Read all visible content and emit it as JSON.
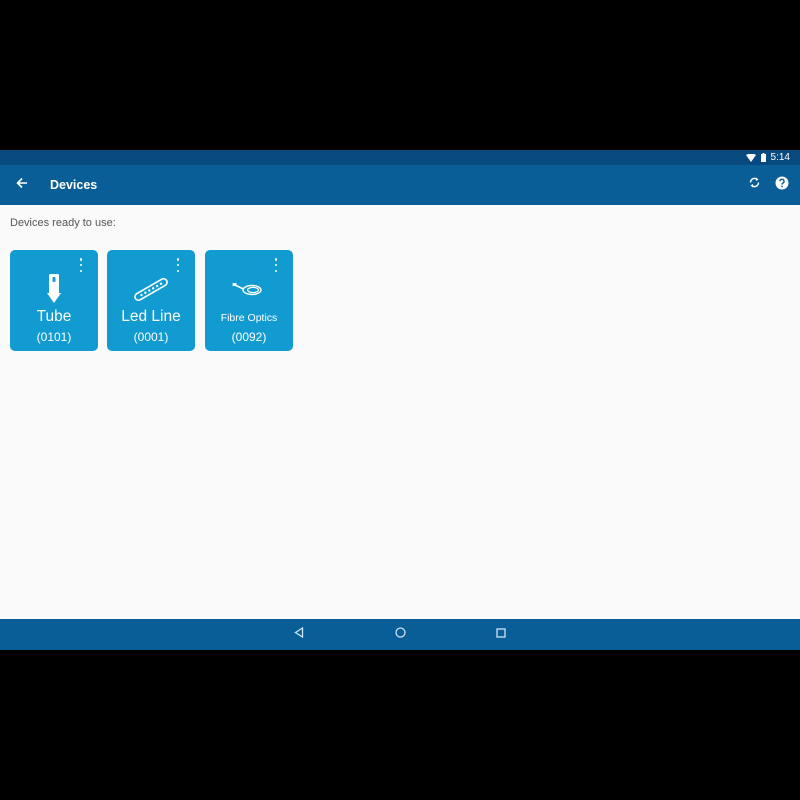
{
  "status_bar": {
    "time": "5:14",
    "icons": [
      "wifi-icon",
      "battery-icon"
    ]
  },
  "app_bar": {
    "title": "Devices",
    "back_icon": "arrow-left-icon",
    "actions": [
      "refresh-icon",
      "help-icon"
    ]
  },
  "content": {
    "section_label": "Devices ready to use:",
    "devices": [
      {
        "name": "Tube",
        "code": "(0101)",
        "icon": "tube-icon"
      },
      {
        "name": "Led Line",
        "code": "(0001)",
        "icon": "led-line-icon"
      },
      {
        "name": "Fibre Optics",
        "code": "(0092)",
        "icon": "fibre-optics-icon"
      }
    ]
  },
  "nav_bar": {
    "buttons": [
      "back-triangle-icon",
      "home-circle-icon",
      "recents-square-icon"
    ]
  },
  "colors": {
    "status_bar": "#094a7e",
    "app_bar": "#0a5e97",
    "tile": "#129bd1",
    "background": "#fafafa"
  }
}
